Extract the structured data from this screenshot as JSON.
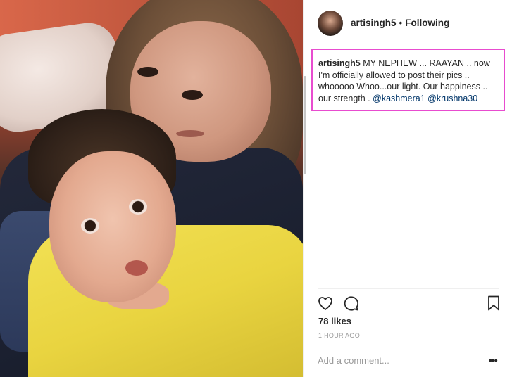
{
  "post": {
    "photo_alt": "",
    "username": "artisingh5",
    "separator": "•",
    "follow_status": "Following",
    "caption": {
      "user": "artisingh5",
      "text": "MY NEPHEW ... RAAYAN .. now I'm officially allowed to post their pics .. whooooo Whoo...our light. Our happiness .. our strength . ",
      "mention_1": "@kashmera1",
      "mention_2": "@krushna30"
    },
    "likes": "78 likes",
    "timestamp": "1 HOUR AGO",
    "comment_placeholder": "Add a comment...",
    "more_label": "•••"
  },
  "icons": {
    "like": "heart-icon",
    "comment": "comment-icon",
    "save": "bookmark-icon",
    "more": "more-options-icon"
  },
  "colors": {
    "highlight_border": "#e84ccf",
    "mention": "#003569",
    "secondary_text": "#999999"
  }
}
